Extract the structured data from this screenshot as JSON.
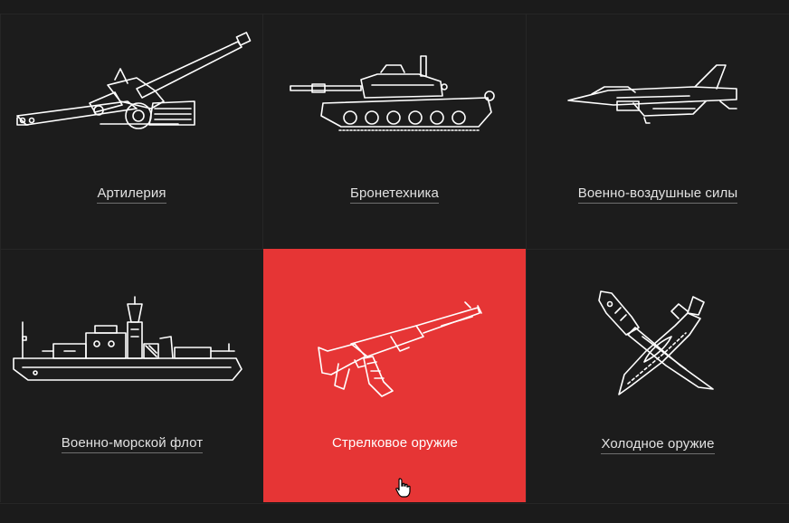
{
  "categories": [
    {
      "label": "Артилерия",
      "icon": "artillery-icon"
    },
    {
      "label": "Бронетехника",
      "icon": "tank-icon"
    },
    {
      "label": "Военно-воздушные силы",
      "icon": "fighter-jet-icon"
    },
    {
      "label": "Военно-морской флот",
      "icon": "warship-icon"
    },
    {
      "label": "Стрелковое оружие",
      "icon": "rifle-icon",
      "state": "hover"
    },
    {
      "label": "Холодное оружие",
      "icon": "knives-icon"
    }
  ],
  "colors": {
    "background": "#1c1c1c",
    "active_tile": "#e63535",
    "line_art": "#ffffff",
    "label_text": "#e2e2e2"
  }
}
